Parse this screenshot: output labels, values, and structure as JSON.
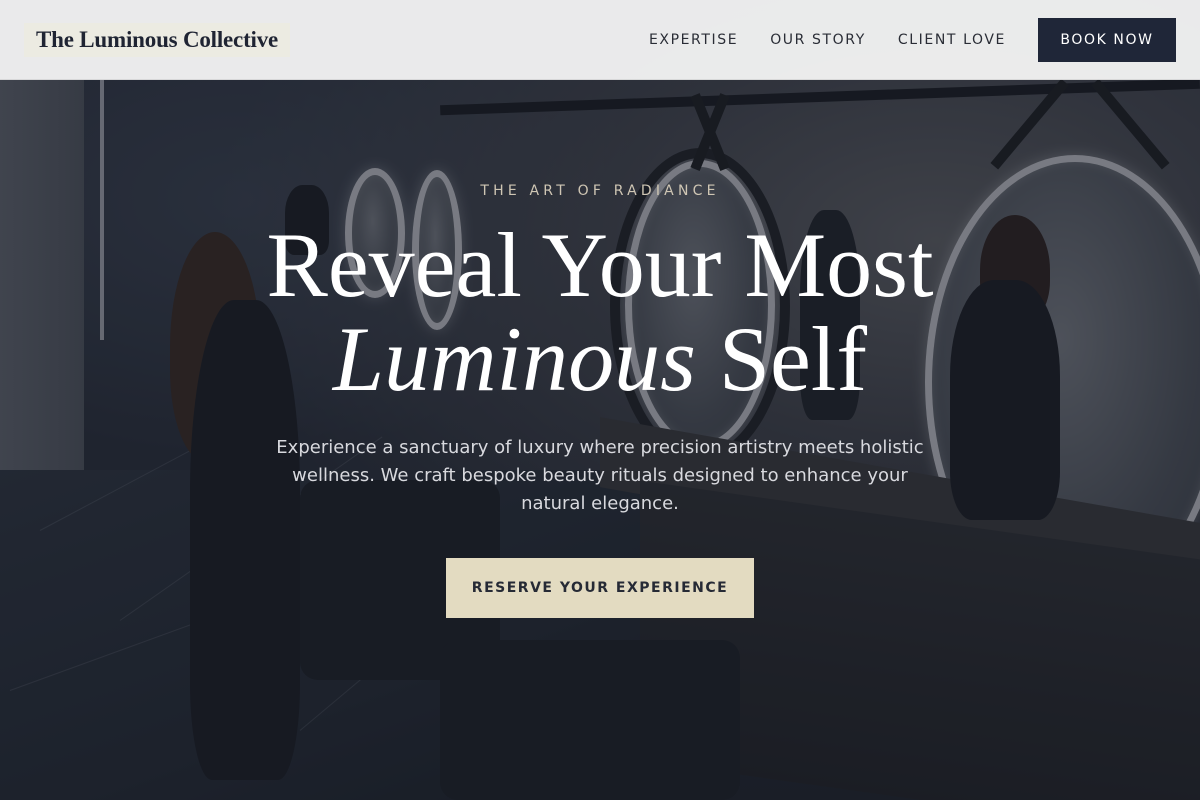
{
  "header": {
    "logo": "The Luminous Collective",
    "nav": [
      {
        "label": "EXPERTISE"
      },
      {
        "label": "OUR STORY"
      },
      {
        "label": "CLIENT LOVE"
      }
    ],
    "cta_label": "BOOK NOW"
  },
  "hero": {
    "eyebrow": "THE ART OF RADIANCE",
    "headline_line1": "Reveal Your Most",
    "headline_em": "Luminous",
    "headline_rest": "Self",
    "subtext": "Experience a sanctuary of luxury where precision artistry meets holistic wellness. We craft bespoke beauty rituals designed to enhance your natural elegance.",
    "cta_label": "RESERVE YOUR EXPERIENCE",
    "background_image": "salon-interior-photo"
  },
  "colors": {
    "header_bg": "#f6f6f6",
    "brand_navy": "#1f2638",
    "accent_cream": "#e3dbc1",
    "overlay": "#1c202c"
  }
}
